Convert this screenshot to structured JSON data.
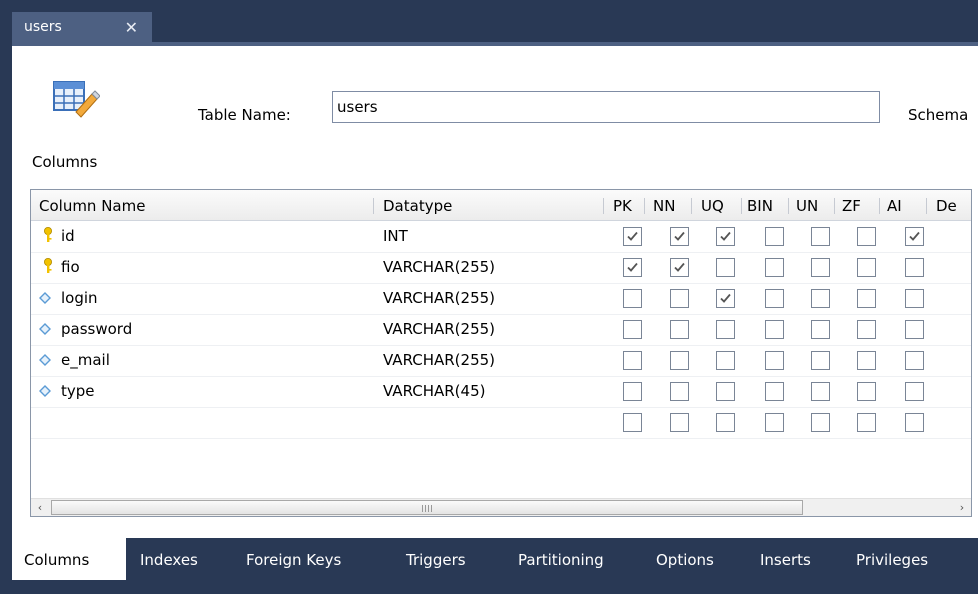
{
  "document_tab": {
    "title": "users",
    "close_glyph": "✕"
  },
  "header": {
    "table_name_label": "Table Name:",
    "table_name_value": "users",
    "schema_label": "Schema"
  },
  "columns_section_label": "Columns",
  "grid": {
    "headers": {
      "column_name": "Column Name",
      "datatype": "Datatype",
      "flags": [
        "PK",
        "NN",
        "UQ",
        "BIN",
        "UN",
        "ZF",
        "AI"
      ],
      "default_partial": "De"
    },
    "rows": [
      {
        "name": "id",
        "icon": "primary-key-icon",
        "datatype": "INT",
        "flags": [
          true,
          true,
          true,
          false,
          false,
          false,
          true
        ]
      },
      {
        "name": "fio",
        "icon": "primary-key-icon",
        "datatype": "VARCHAR(255)",
        "flags": [
          true,
          true,
          false,
          false,
          false,
          false,
          false
        ]
      },
      {
        "name": "login",
        "icon": "column-diamond-icon",
        "datatype": "VARCHAR(255)",
        "flags": [
          false,
          false,
          true,
          false,
          false,
          false,
          false
        ]
      },
      {
        "name": "password",
        "icon": "column-diamond-icon",
        "datatype": "VARCHAR(255)",
        "flags": [
          false,
          false,
          false,
          false,
          false,
          false,
          false
        ]
      },
      {
        "name": "e_mail",
        "icon": "column-diamond-icon",
        "datatype": "VARCHAR(255)",
        "flags": [
          false,
          false,
          false,
          false,
          false,
          false,
          false
        ]
      },
      {
        "name": "type",
        "icon": "column-diamond-icon",
        "datatype": "VARCHAR(45)",
        "flags": [
          false,
          false,
          false,
          false,
          false,
          false,
          false
        ]
      },
      {
        "name": "",
        "icon": "",
        "datatype": "",
        "flags": [
          false,
          false,
          false,
          false,
          false,
          false,
          false
        ]
      }
    ],
    "scroll_left_glyph": "‹",
    "scroll_right_glyph": "›"
  },
  "bottom_tabs": [
    {
      "label": "Columns",
      "active": true
    },
    {
      "label": "Indexes",
      "active": false
    },
    {
      "label": "Foreign Keys",
      "active": false
    },
    {
      "label": "Triggers",
      "active": false
    },
    {
      "label": "Partitioning",
      "active": false
    },
    {
      "label": "Options",
      "active": false
    },
    {
      "label": "Inserts",
      "active": false
    },
    {
      "label": "Privileges",
      "active": false
    }
  ],
  "colors": {
    "chrome": "#293955",
    "tab": "#4d6082",
    "key": "#f2c200",
    "diamond": "#5b9bd5",
    "check": "#555555"
  }
}
